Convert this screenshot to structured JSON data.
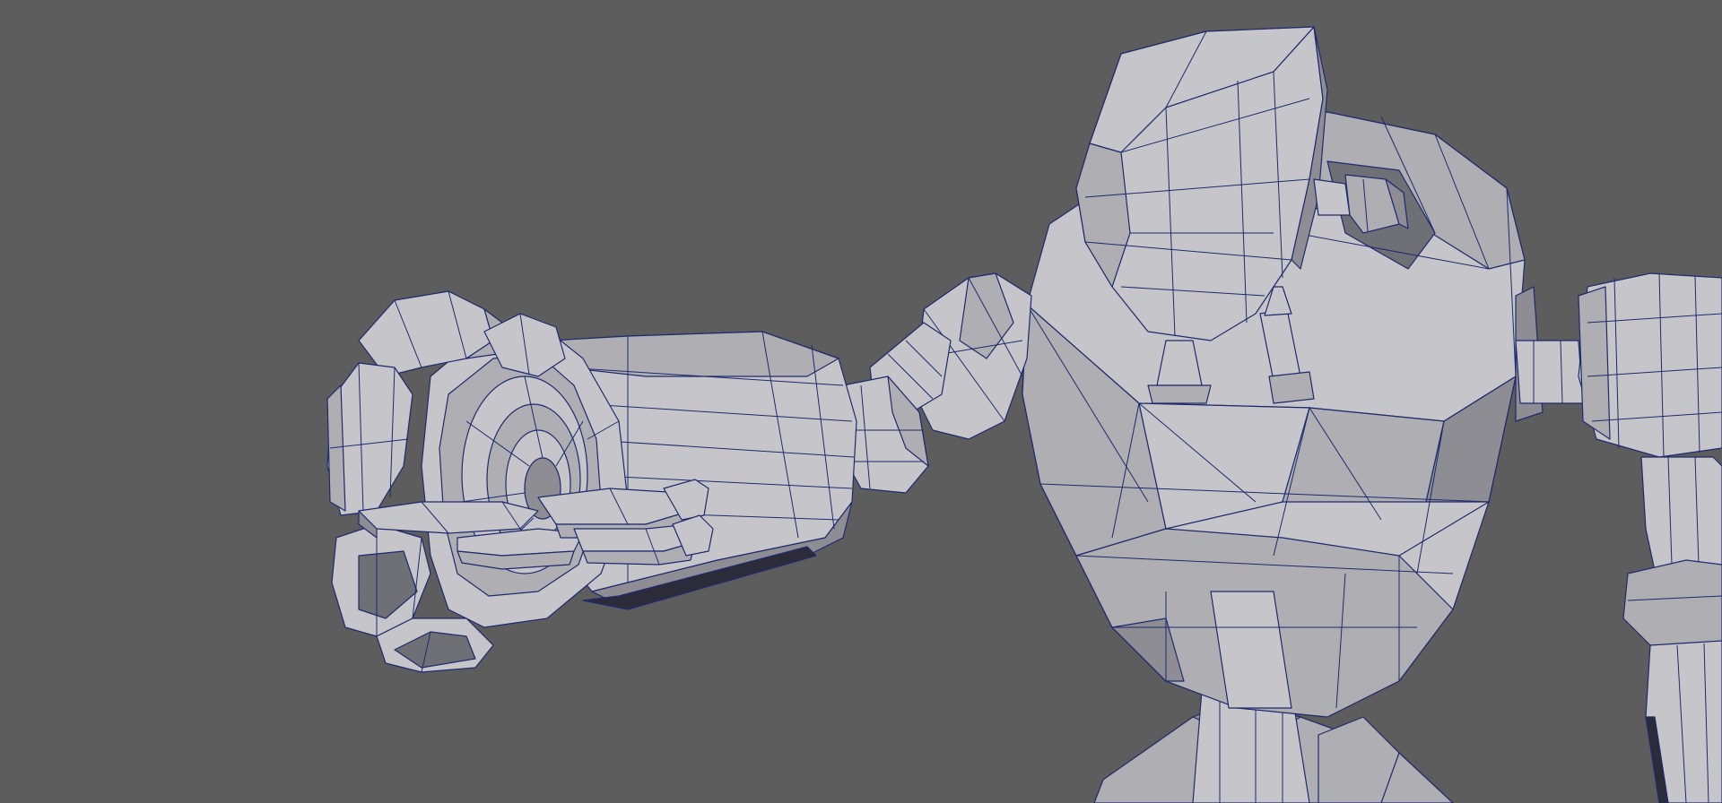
{
  "viewport": {
    "background": "#5d5d5d",
    "wireframe_color": "#1e2a6e",
    "shading": "smooth-shade-wireframe-on-shaded"
  },
  "scene": {
    "model": "robot-character-mesh",
    "visible_parts": [
      "head",
      "torso",
      "left-arm-forearm",
      "left-claw-hand",
      "right-shoulder",
      "right-arm",
      "neck-pistons",
      "hips"
    ]
  }
}
